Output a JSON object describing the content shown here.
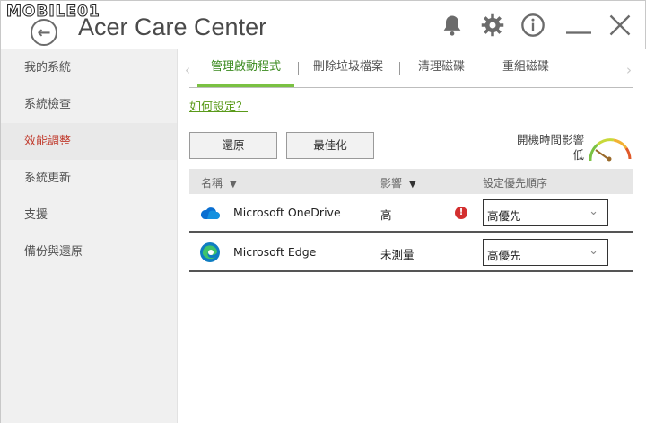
{
  "watermark": "MOBILE01",
  "app": {
    "title": "Acer Care Center"
  },
  "titlebar": {
    "icons": [
      "bell-icon",
      "gear-icon",
      "info-icon",
      "minimize-icon",
      "close-icon"
    ]
  },
  "sidebar": {
    "items": [
      {
        "label": "我的系統"
      },
      {
        "label": "系統檢查"
      },
      {
        "label": "效能調整",
        "active": true
      },
      {
        "label": "系統更新"
      },
      {
        "label": "支援"
      },
      {
        "label": "備份與還原"
      }
    ]
  },
  "tabs": [
    {
      "label": "管理啟動程式",
      "active": true
    },
    {
      "label": "刪除垃圾檔案"
    },
    {
      "label": "清理磁碟"
    },
    {
      "label": "重組磁碟"
    }
  ],
  "howto": "如何設定？",
  "buttons": {
    "restore": "還原",
    "optimize": "最佳化"
  },
  "boot_impact": {
    "label": "開機時間影響",
    "value": "低"
  },
  "table": {
    "headers": {
      "name": "名稱",
      "impact": "影響",
      "priority": "設定優先順序"
    },
    "rows": [
      {
        "name": "Microsoft OneDrive",
        "impact": "高",
        "warning": true,
        "priority": "高優先"
      },
      {
        "name": "Microsoft Edge",
        "impact": "未測量",
        "warning": false,
        "priority": "高優先"
      }
    ]
  },
  "colors": {
    "accent_green": "#7ac142",
    "active_red": "#c0392b",
    "warning_red": "#d32f2f",
    "onedrive_blue": "#0a6fd1"
  }
}
